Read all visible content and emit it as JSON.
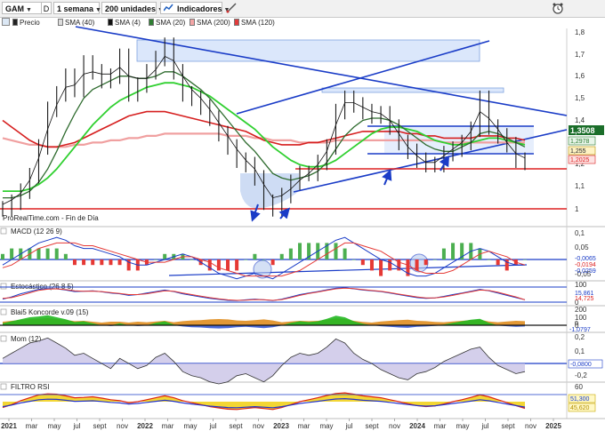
{
  "toolbar": {
    "instrument": "GAM",
    "d_label": "D",
    "period": "1 semana",
    "units": "200 unidades",
    "indicators": "Indicadores"
  },
  "legend": [
    {
      "label": "Precio",
      "color": "#222222"
    },
    {
      "label": "SMA (40)",
      "color": "#dddddd"
    },
    {
      "label": "SMA (4)",
      "color": "#111111"
    },
    {
      "label": "SMA (20)",
      "color": "#2e7d32"
    },
    {
      "label": "SMA (200)",
      "color": "#f4a6a6"
    },
    {
      "label": "SMA (120)",
      "color": "#e23b3b"
    }
  ],
  "source_text": "ProRealTime.com - Fin de Día",
  "price_badges": {
    "last": "1,3508",
    "sma20": "1,2978",
    "sma4": "1,255",
    "sma40": "1,2025"
  },
  "chart_data": [
    {
      "type": "line",
      "panel": "price",
      "ylim": [
        0.95,
        1.85
      ],
      "yticks": [
        "1,8",
        "1,7",
        "1,6",
        "1,5",
        "1,4",
        "1,2",
        "1,1",
        "1"
      ],
      "xlabels": [
        "2021",
        "mar",
        "may",
        "jul",
        "sept",
        "nov",
        "2022",
        "mar",
        "may",
        "jul",
        "sept",
        "nov",
        "2023",
        "mar",
        "may",
        "jul",
        "sept",
        "nov",
        "2024",
        "mar",
        "may",
        "jul",
        "sept",
        "nov",
        "2025"
      ],
      "series": [
        {
          "name": "Precio",
          "values": [
            1.0,
            1.03,
            1.08,
            1.15,
            1.28,
            1.45,
            1.52,
            1.6,
            1.54,
            1.66,
            1.62,
            1.58,
            1.6,
            1.69,
            1.52,
            1.56,
            1.62,
            1.68,
            1.74,
            1.62,
            1.52,
            1.5,
            1.46,
            1.41,
            1.34,
            1.28,
            1.22,
            1.2,
            1.14,
            1.03,
            1.0,
            1.06,
            1.12,
            1.16,
            1.16,
            1.21,
            1.28,
            1.44,
            1.5,
            1.47,
            1.44,
            1.42,
            1.43,
            1.37,
            1.3,
            1.26,
            1.22,
            1.2,
            1.2,
            1.25,
            1.27,
            1.3,
            1.36,
            1.5,
            1.37,
            1.33,
            1.29,
            1.22,
            1.21
          ]
        },
        {
          "name": "SMA (4)",
          "values": [
            1.02,
            1.04,
            1.07,
            1.13,
            1.23,
            1.36,
            1.47,
            1.55,
            1.56,
            1.61,
            1.62,
            1.61,
            1.61,
            1.64,
            1.6,
            1.59,
            1.59,
            1.63,
            1.69,
            1.67,
            1.6,
            1.54,
            1.5,
            1.45,
            1.39,
            1.33,
            1.27,
            1.22,
            1.18,
            1.11,
            1.05,
            1.06,
            1.09,
            1.13,
            1.16,
            1.2,
            1.26,
            1.38,
            1.48,
            1.48,
            1.46,
            1.44,
            1.43,
            1.4,
            1.34,
            1.28,
            1.24,
            1.21,
            1.21,
            1.24,
            1.27,
            1.3,
            1.35,
            1.44,
            1.41,
            1.36,
            1.3,
            1.25,
            1.23
          ]
        },
        {
          "name": "SMA (20)",
          "values": [
            1.05,
            1.05,
            1.06,
            1.08,
            1.12,
            1.18,
            1.26,
            1.35,
            1.43,
            1.5,
            1.54,
            1.56,
            1.58,
            1.6,
            1.6,
            1.59,
            1.59,
            1.6,
            1.62,
            1.62,
            1.6,
            1.57,
            1.54,
            1.5,
            1.45,
            1.4,
            1.35,
            1.3,
            1.26,
            1.21,
            1.16,
            1.14,
            1.13,
            1.14,
            1.15,
            1.17,
            1.21,
            1.27,
            1.33,
            1.37,
            1.4,
            1.41,
            1.41,
            1.4,
            1.38,
            1.35,
            1.32,
            1.29,
            1.27,
            1.26,
            1.26,
            1.28,
            1.3,
            1.34,
            1.35,
            1.34,
            1.32,
            1.3,
            1.28
          ]
        },
        {
          "name": "SMA (40)",
          "values": [
            1.08,
            1.08,
            1.08,
            1.09,
            1.11,
            1.14,
            1.18,
            1.23,
            1.28,
            1.33,
            1.38,
            1.42,
            1.46,
            1.49,
            1.51,
            1.53,
            1.55,
            1.56,
            1.57,
            1.57,
            1.56,
            1.55,
            1.53,
            1.51,
            1.48,
            1.45,
            1.42,
            1.39,
            1.36,
            1.32,
            1.28,
            1.25,
            1.22,
            1.2,
            1.19,
            1.19,
            1.2,
            1.22,
            1.25,
            1.28,
            1.31,
            1.34,
            1.36,
            1.37,
            1.37,
            1.36,
            1.35,
            1.33,
            1.31,
            1.3,
            1.29,
            1.29,
            1.3,
            1.31,
            1.32,
            1.32,
            1.31,
            1.3,
            1.29
          ]
        },
        {
          "name": "SMA (120)",
          "values": [
            1.4,
            1.37,
            1.34,
            1.31,
            1.29,
            1.28,
            1.28,
            1.29,
            1.3,
            1.32,
            1.34,
            1.36,
            1.38,
            1.4,
            1.42,
            1.43,
            1.44,
            1.44,
            1.44,
            1.43,
            1.42,
            1.41,
            1.4,
            1.39,
            1.38,
            1.37,
            1.36,
            1.35,
            1.33,
            1.31,
            1.3,
            1.29,
            1.29,
            1.29,
            1.3,
            1.3,
            1.31,
            1.32,
            1.33,
            1.34,
            1.35,
            1.35,
            1.35,
            1.35,
            1.35,
            1.34,
            1.34,
            1.33,
            1.33,
            1.32,
            1.32,
            1.32,
            1.32,
            1.33,
            1.33,
            1.33,
            1.32,
            1.32,
            1.31
          ]
        },
        {
          "name": "SMA (200)",
          "values": [
            1.32,
            1.31,
            1.3,
            1.29,
            1.29,
            1.28,
            1.28,
            1.28,
            1.29,
            1.29,
            1.3,
            1.3,
            1.31,
            1.31,
            1.32,
            1.32,
            1.33,
            1.33,
            1.34,
            1.34,
            1.34,
            1.34,
            1.34,
            1.34,
            1.34,
            1.33,
            1.33,
            1.33,
            1.32,
            1.32,
            1.31,
            1.31,
            1.31,
            1.3,
            1.3,
            1.3,
            1.3,
            1.31,
            1.31,
            1.31,
            1.31,
            1.31,
            1.31,
            1.31,
            1.31,
            1.31,
            1.31,
            1.31,
            1.31,
            1.3,
            1.3,
            1.3,
            1.3,
            1.3,
            1.3,
            1.3,
            1.3,
            1.3,
            1.3
          ]
        }
      ]
    },
    {
      "type": "line",
      "panel": "macd",
      "name": "MACD (12 26 9)",
      "yticks": [
        "0,1",
        "0,05",
        "-0,05"
      ],
      "badges": [
        "-0,0065",
        "-0,0194",
        "-0,0259"
      ],
      "series": [
        {
          "name": "MACD",
          "values": [
            -0.02,
            0.0,
            0.02,
            0.04,
            0.06,
            0.07,
            0.08,
            0.07,
            0.05,
            0.04,
            0.04,
            0.03,
            0.02,
            0.01,
            -0.01,
            -0.02,
            -0.02,
            -0.01,
            0.0,
            0.01,
            0.02,
            0.01,
            -0.01,
            -0.03,
            -0.05,
            -0.06,
            -0.07,
            -0.06,
            -0.05,
            -0.06,
            -0.07,
            -0.05,
            -0.03,
            -0.01,
            0.01,
            0.03,
            0.05,
            0.07,
            0.08,
            0.06,
            0.04,
            0.02,
            0.0,
            -0.01,
            -0.03,
            -0.05,
            -0.06,
            -0.06,
            -0.05,
            -0.03,
            -0.01,
            0.01,
            0.03,
            0.04,
            0.03,
            0.01,
            -0.01,
            -0.02,
            -0.02
          ]
        },
        {
          "name": "Signal",
          "values": [
            -0.03,
            -0.02,
            0.0,
            0.02,
            0.04,
            0.05,
            0.06,
            0.06,
            0.06,
            0.05,
            0.05,
            0.04,
            0.03,
            0.02,
            0.01,
            0.0,
            -0.01,
            -0.01,
            -0.01,
            0.0,
            0.01,
            0.01,
            0.0,
            -0.01,
            -0.03,
            -0.04,
            -0.05,
            -0.06,
            -0.06,
            -0.06,
            -0.06,
            -0.06,
            -0.05,
            -0.04,
            -0.02,
            0.0,
            0.02,
            0.04,
            0.06,
            0.06,
            0.05,
            0.04,
            0.03,
            0.01,
            -0.01,
            -0.02,
            -0.04,
            -0.05,
            -0.05,
            -0.05,
            -0.04,
            -0.02,
            0.0,
            0.02,
            0.03,
            0.02,
            0.01,
            -0.01,
            -0.02
          ]
        }
      ]
    },
    {
      "type": "line",
      "panel": "stoch",
      "name": "Estocástico (26 8 5)",
      "yticks": [
        "100",
        "0"
      ],
      "badges": [
        "15,861",
        "14,725"
      ],
      "series": [
        {
          "name": "%K",
          "values": [
            20,
            35,
            55,
            70,
            85,
            90,
            88,
            80,
            70,
            72,
            75,
            68,
            60,
            55,
            45,
            50,
            60,
            70,
            80,
            70,
            55,
            45,
            35,
            25,
            18,
            12,
            10,
            15,
            20,
            15,
            10,
            20,
            35,
            50,
            60,
            70,
            82,
            92,
            95,
            88,
            80,
            75,
            70,
            60,
            50,
            40,
            30,
            25,
            28,
            38,
            50,
            60,
            72,
            85,
            75,
            60,
            45,
            30,
            16
          ]
        },
        {
          "name": "%D",
          "values": [
            25,
            30,
            45,
            62,
            78,
            86,
            88,
            83,
            75,
            72,
            73,
            70,
            63,
            57,
            50,
            50,
            55,
            65,
            75,
            72,
            60,
            50,
            40,
            30,
            22,
            15,
            12,
            13,
            17,
            16,
            12,
            17,
            30,
            45,
            57,
            67,
            78,
            88,
            93,
            90,
            83,
            77,
            72,
            63,
            53,
            44,
            35,
            28,
            28,
            35,
            45,
            57,
            68,
            80,
            77,
            65,
            50,
            35,
            15
          ]
        }
      ]
    },
    {
      "type": "area",
      "panel": "koncorde",
      "name": "Blai5 Koncorde v.09 (15)",
      "yticks": [
        "200",
        "100",
        "0"
      ],
      "badges": [
        "0",
        "-1,0797"
      ]
    },
    {
      "type": "area",
      "panel": "momentum",
      "name": "Mom (12)",
      "yticks": [
        "0,2",
        "0,1",
        "-0,2"
      ],
      "badges": [
        "-0,0800"
      ],
      "series": [
        {
          "name": "Mom (12)",
          "values": [
            0.05,
            0.1,
            0.15,
            0.2,
            0.22,
            0.25,
            0.2,
            0.15,
            0.08,
            0.1,
            0.05,
            0.0,
            -0.05,
            0.05,
            0.0,
            -0.05,
            -0.02,
            0.06,
            0.1,
            0.02,
            -0.08,
            -0.12,
            -0.14,
            -0.18,
            -0.2,
            -0.18,
            -0.12,
            -0.1,
            -0.14,
            -0.18,
            -0.12,
            -0.02,
            0.06,
            0.1,
            0.08,
            0.1,
            0.16,
            0.24,
            0.2,
            0.1,
            0.04,
            0.0,
            -0.06,
            -0.1,
            -0.14,
            -0.16,
            -0.1,
            -0.08,
            -0.04,
            0.02,
            0.06,
            0.1,
            0.14,
            0.16,
            0.06,
            -0.02,
            -0.06,
            -0.1,
            -0.08
          ]
        }
      ]
    },
    {
      "type": "area",
      "panel": "rsi",
      "name": "FILTRO RSI",
      "yticks": [
        "60"
      ],
      "badges": [
        "51,300",
        "45,620"
      ]
    }
  ]
}
